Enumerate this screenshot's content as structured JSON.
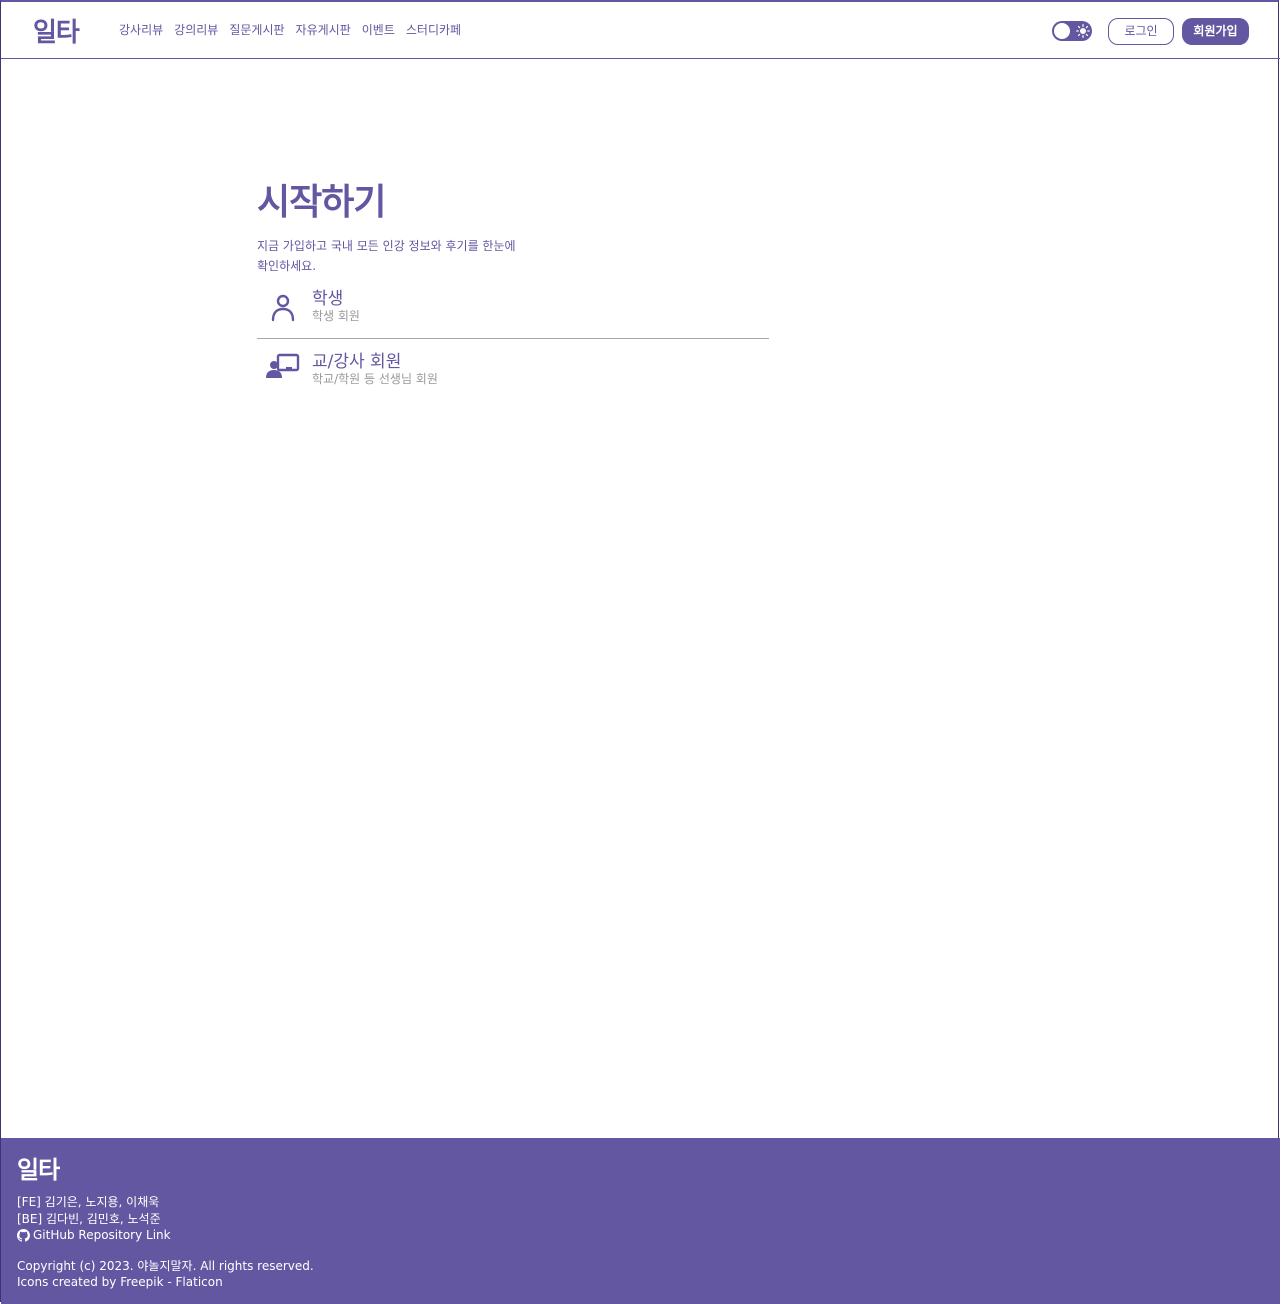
{
  "header": {
    "logo": "일타",
    "nav": [
      "강사리뷰",
      "강의리뷰",
      "질문게시판",
      "자유게시판",
      "이벤트",
      "스터디카페"
    ],
    "theme_toggle_icon": "sun-icon",
    "login_label": "로그인",
    "signup_label": "회원가입"
  },
  "main": {
    "title": "시작하기",
    "description": "지금 가입하고 국내 모든 인강 정보와 후기를 한눈에 확인하세요.",
    "options": [
      {
        "title": "학생",
        "subtitle": "학생 회원",
        "icon": "user-icon"
      },
      {
        "title": "교/강사 회원",
        "subtitle": "학교/학원 등 선생님 회원",
        "icon": "teacher-board-icon"
      }
    ]
  },
  "footer": {
    "logo": "일타",
    "fe_members": "[FE] 김기은, 노지용, 이채욱",
    "be_members": "[BE] 김다빈, 김민호, 노석준",
    "repo_link": "GitHub Repository Link",
    "copyright": "Copyright (c) 2023. 야놀지말자. All rights reserved.",
    "icons_credit": "Icons created by Freepik - Flaticon"
  },
  "colors": {
    "accent": "#6257A0",
    "muted_text": "#9a9a9a",
    "divider": "#a9a9a9"
  }
}
